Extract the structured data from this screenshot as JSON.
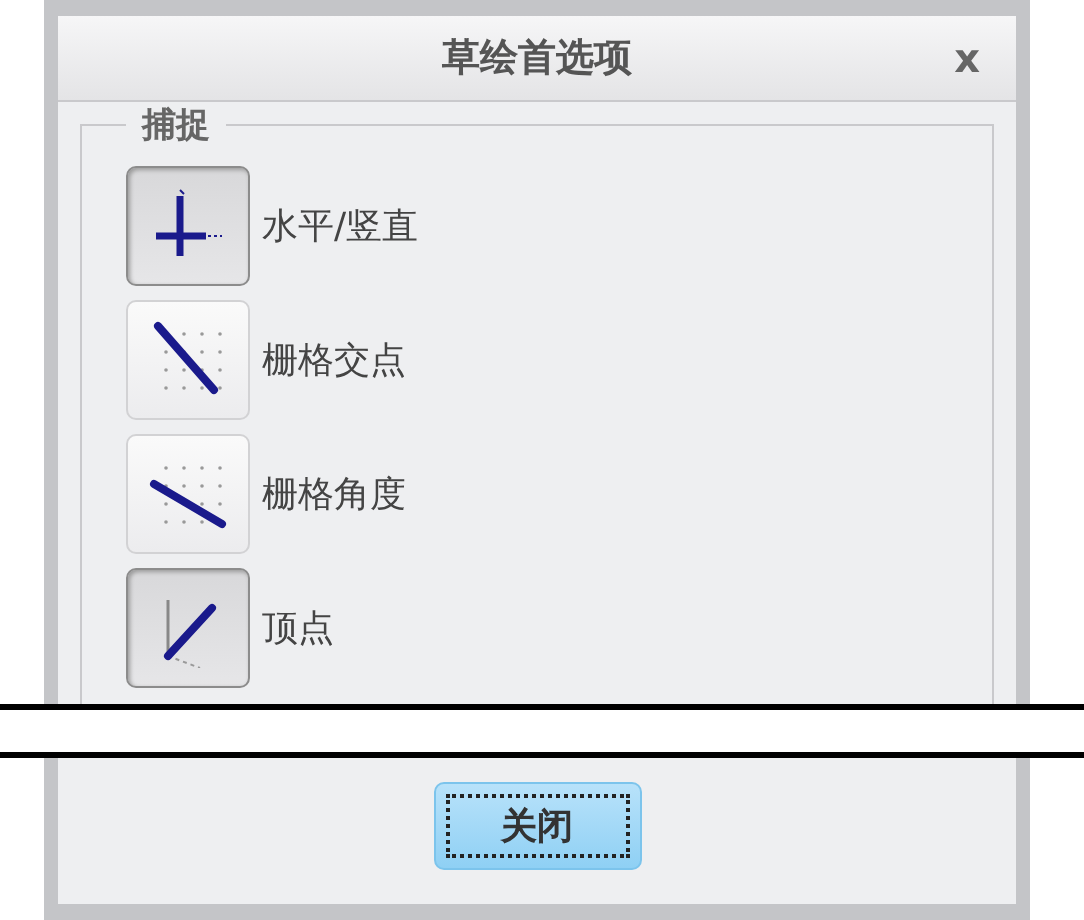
{
  "window": {
    "title": "草绘首选项",
    "close": "x"
  },
  "snap": {
    "legend": "捕捉",
    "items": [
      {
        "kind": "axes",
        "label": "水平/竖直",
        "selected": true
      },
      {
        "kind": "gridpoint",
        "label": "栅格交点",
        "selected": false
      },
      {
        "kind": "gridangle",
        "label": "栅格角度",
        "selected": false
      },
      {
        "kind": "vertex",
        "label": "顶点",
        "selected": true
      }
    ]
  },
  "buttons": [
    {
      "label": "关闭",
      "focused": true
    }
  ]
}
